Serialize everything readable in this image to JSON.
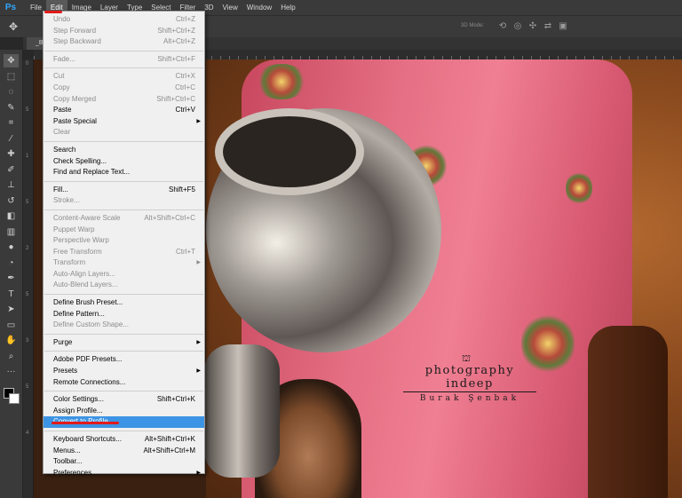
{
  "app": {
    "logo": "Ps"
  },
  "menubar": [
    "File",
    "Edit",
    "Image",
    "Layer",
    "Type",
    "Select",
    "Filter",
    "3D",
    "View",
    "Window",
    "Help"
  ],
  "active_menu": "Edit",
  "options_bar": {
    "mode_label": "3D Mode:"
  },
  "doc_tab": {
    "label": "_BU"
  },
  "ruler_left_labels": [
    "0",
    "5",
    "1",
    "5",
    "2",
    "5",
    "3",
    "5",
    "4"
  ],
  "watermark": {
    "title": "photography indeep",
    "name": "Burak Şenbak"
  },
  "edit_menu": [
    {
      "label": "Undo",
      "shortcut": "Ctrl+Z",
      "disabled": true
    },
    {
      "label": "Step Forward",
      "shortcut": "Shift+Ctrl+Z",
      "disabled": true
    },
    {
      "label": "Step Backward",
      "shortcut": "Alt+Ctrl+Z",
      "disabled": true
    },
    {
      "sep": true
    },
    {
      "label": "Fade...",
      "shortcut": "Shift+Ctrl+F",
      "disabled": true
    },
    {
      "sep": true
    },
    {
      "label": "Cut",
      "shortcut": "Ctrl+X",
      "disabled": true
    },
    {
      "label": "Copy",
      "shortcut": "Ctrl+C",
      "disabled": true
    },
    {
      "label": "Copy Merged",
      "shortcut": "Shift+Ctrl+C",
      "disabled": true
    },
    {
      "label": "Paste",
      "shortcut": "Ctrl+V",
      "disabled": false
    },
    {
      "label": "Paste Special",
      "shortcut": "",
      "submenu": true,
      "disabled": false
    },
    {
      "label": "Clear",
      "shortcut": "",
      "disabled": true
    },
    {
      "sep": true
    },
    {
      "label": "Search",
      "shortcut": "",
      "disabled": false
    },
    {
      "label": "Check Spelling...",
      "shortcut": "",
      "disabled": false
    },
    {
      "label": "Find and Replace Text...",
      "shortcut": "",
      "disabled": false
    },
    {
      "sep": true
    },
    {
      "label": "Fill...",
      "shortcut": "Shift+F5",
      "disabled": false
    },
    {
      "label": "Stroke...",
      "shortcut": "",
      "disabled": true
    },
    {
      "sep": true
    },
    {
      "label": "Content-Aware Scale",
      "shortcut": "Alt+Shift+Ctrl+C",
      "disabled": true
    },
    {
      "label": "Puppet Warp",
      "shortcut": "",
      "disabled": true
    },
    {
      "label": "Perspective Warp",
      "shortcut": "",
      "disabled": true
    },
    {
      "label": "Free Transform",
      "shortcut": "Ctrl+T",
      "disabled": true
    },
    {
      "label": "Transform",
      "shortcut": "",
      "submenu": true,
      "disabled": true
    },
    {
      "label": "Auto-Align Layers...",
      "shortcut": "",
      "disabled": true
    },
    {
      "label": "Auto-Blend Layers...",
      "shortcut": "",
      "disabled": true
    },
    {
      "sep": true
    },
    {
      "label": "Define Brush Preset...",
      "shortcut": "",
      "disabled": false
    },
    {
      "label": "Define Pattern...",
      "shortcut": "",
      "disabled": false
    },
    {
      "label": "Define Custom Shape...",
      "shortcut": "",
      "disabled": true
    },
    {
      "sep": true
    },
    {
      "label": "Purge",
      "shortcut": "",
      "submenu": true,
      "disabled": false
    },
    {
      "sep": true
    },
    {
      "label": "Adobe PDF Presets...",
      "shortcut": "",
      "disabled": false
    },
    {
      "label": "Presets",
      "shortcut": "",
      "submenu": true,
      "disabled": false
    },
    {
      "label": "Remote Connections...",
      "shortcut": "",
      "disabled": false
    },
    {
      "sep": true
    },
    {
      "label": "Color Settings...",
      "shortcut": "Shift+Ctrl+K",
      "disabled": false
    },
    {
      "label": "Assign Profile...",
      "shortcut": "",
      "disabled": false
    },
    {
      "label": "Convert to Profile...",
      "shortcut": "",
      "disabled": false,
      "highlighted": true
    },
    {
      "sep": true
    },
    {
      "label": "Keyboard Shortcuts...",
      "shortcut": "Alt+Shift+Ctrl+K",
      "disabled": false
    },
    {
      "label": "Menus...",
      "shortcut": "Alt+Shift+Ctrl+M",
      "disabled": false
    },
    {
      "label": "Toolbar...",
      "shortcut": "",
      "disabled": false
    },
    {
      "label": "Preferences",
      "shortcut": "",
      "submenu": true,
      "disabled": false
    }
  ],
  "colors": {
    "highlight": "#3e94e4",
    "annotation_red": "#e21a1a",
    "menu_bg": "#f0f0f0",
    "ui_dark": "#3a3a3a"
  },
  "tools": [
    "move-tool-icon",
    "marquee-tool-icon",
    "lasso-tool-icon",
    "quick-select-tool-icon",
    "crop-tool-icon",
    "eyedropper-tool-icon",
    "healing-brush-icon",
    "brush-tool-icon",
    "clone-stamp-icon",
    "history-brush-icon",
    "eraser-tool-icon",
    "gradient-tool-icon",
    "blur-tool-icon",
    "dodge-tool-icon",
    "pen-tool-icon",
    "type-tool-icon",
    "path-select-icon",
    "rectangle-tool-icon",
    "hand-tool-icon",
    "zoom-tool-icon",
    "more-tools-icon"
  ]
}
